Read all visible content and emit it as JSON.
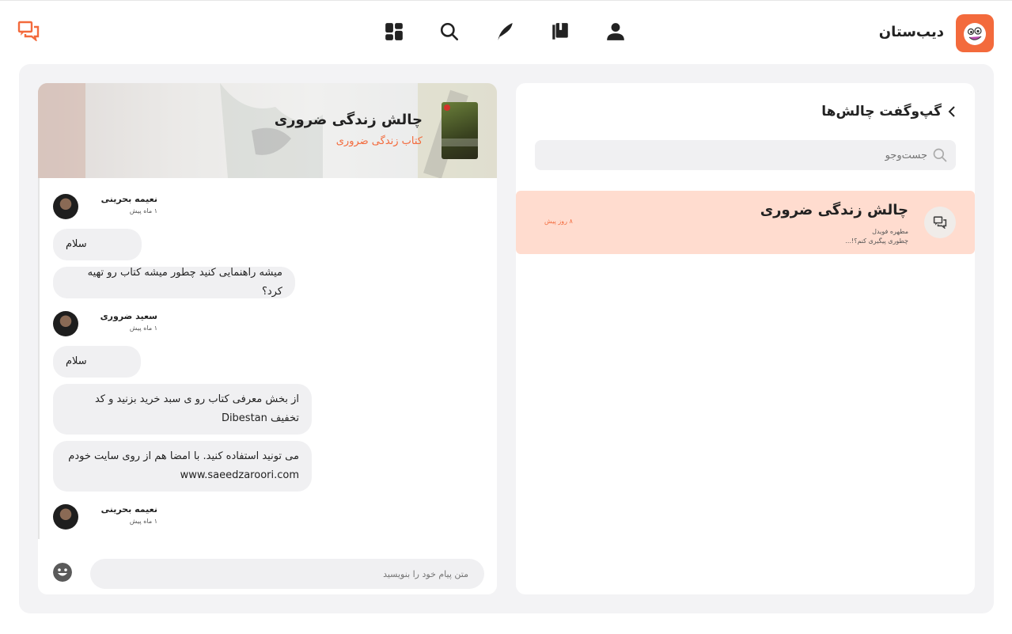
{
  "header": {
    "brand": "دیب‌ستان",
    "nav_icons": [
      "profile-icon",
      "library-icon",
      "quill-icon",
      "search-icon",
      "dashboard-icon"
    ],
    "left_icon": "chat-icon",
    "accent": "#f36a3c"
  },
  "sidebar": {
    "title": "گپ‌وگفت چالش‌ها",
    "search_placeholder": "جست‌وجو",
    "conversations": [
      {
        "title": "چالش زندگی ضروری",
        "author": "مطهره فویدل",
        "preview": "چطوری پیگیری کنم؟!...",
        "time": "۸ روز پیش",
        "highlight": "#ffdccf"
      }
    ]
  },
  "chat": {
    "title": "چالش زندگی ضروری",
    "subtitle": "کتاب زندگی ضروری",
    "messages": [
      {
        "author": "نعیمه بحرینی",
        "time": "۱ ماه پیش",
        "texts": [
          "سلام",
          "میشه راهنمایی کنید چطور میشه کتاب رو تهیه کرد؟"
        ]
      },
      {
        "author": "سعید ضروری",
        "time": "۱ ماه پیش",
        "texts": [
          "سلام",
          "از بخش معرفی کتاب رو ی سبد خرید بزنید و کد تخفیف Dibestan",
          "می تونید استفاده کنید. با امضا هم از روی سایت خودم www.saeedzaroori.com"
        ]
      },
      {
        "author": "نعیمه بحرینی",
        "time": "۱ ماه پیش",
        "texts": []
      }
    ],
    "input_placeholder": "متن پیام خود را بنویسید"
  }
}
